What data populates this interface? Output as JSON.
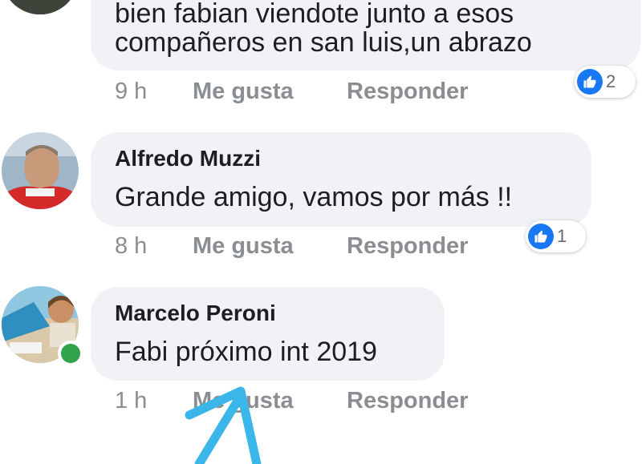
{
  "comments": [
    {
      "text_lines": [
        "bien fabian viendote junto a esos",
        "compañeros en san luis,un abrazo"
      ],
      "time": "9 h",
      "like_label": "Me gusta",
      "reply_label": "Responder",
      "reaction_count": "2"
    },
    {
      "author": "Alfredo Muzzi",
      "text": "Grande amigo, vamos por más !!",
      "time": "8 h",
      "like_label": "Me gusta",
      "reply_label": "Responder",
      "reaction_count": "1"
    },
    {
      "author": "Marcelo Peroni",
      "text": "Fabi próximo int 2019",
      "time": "1 h",
      "like_label": "Me gusta",
      "reply_label": "Responder",
      "online": true
    }
  ],
  "colors": {
    "bubble": "#f0f2f5",
    "like_blue": "#1877f2",
    "meta_gray": "#8a8d91",
    "online_green": "#31a24c",
    "arrow": "#3bb6e8"
  },
  "icons": {
    "reaction": "like-icon",
    "annotation": "arrow-annotation"
  }
}
